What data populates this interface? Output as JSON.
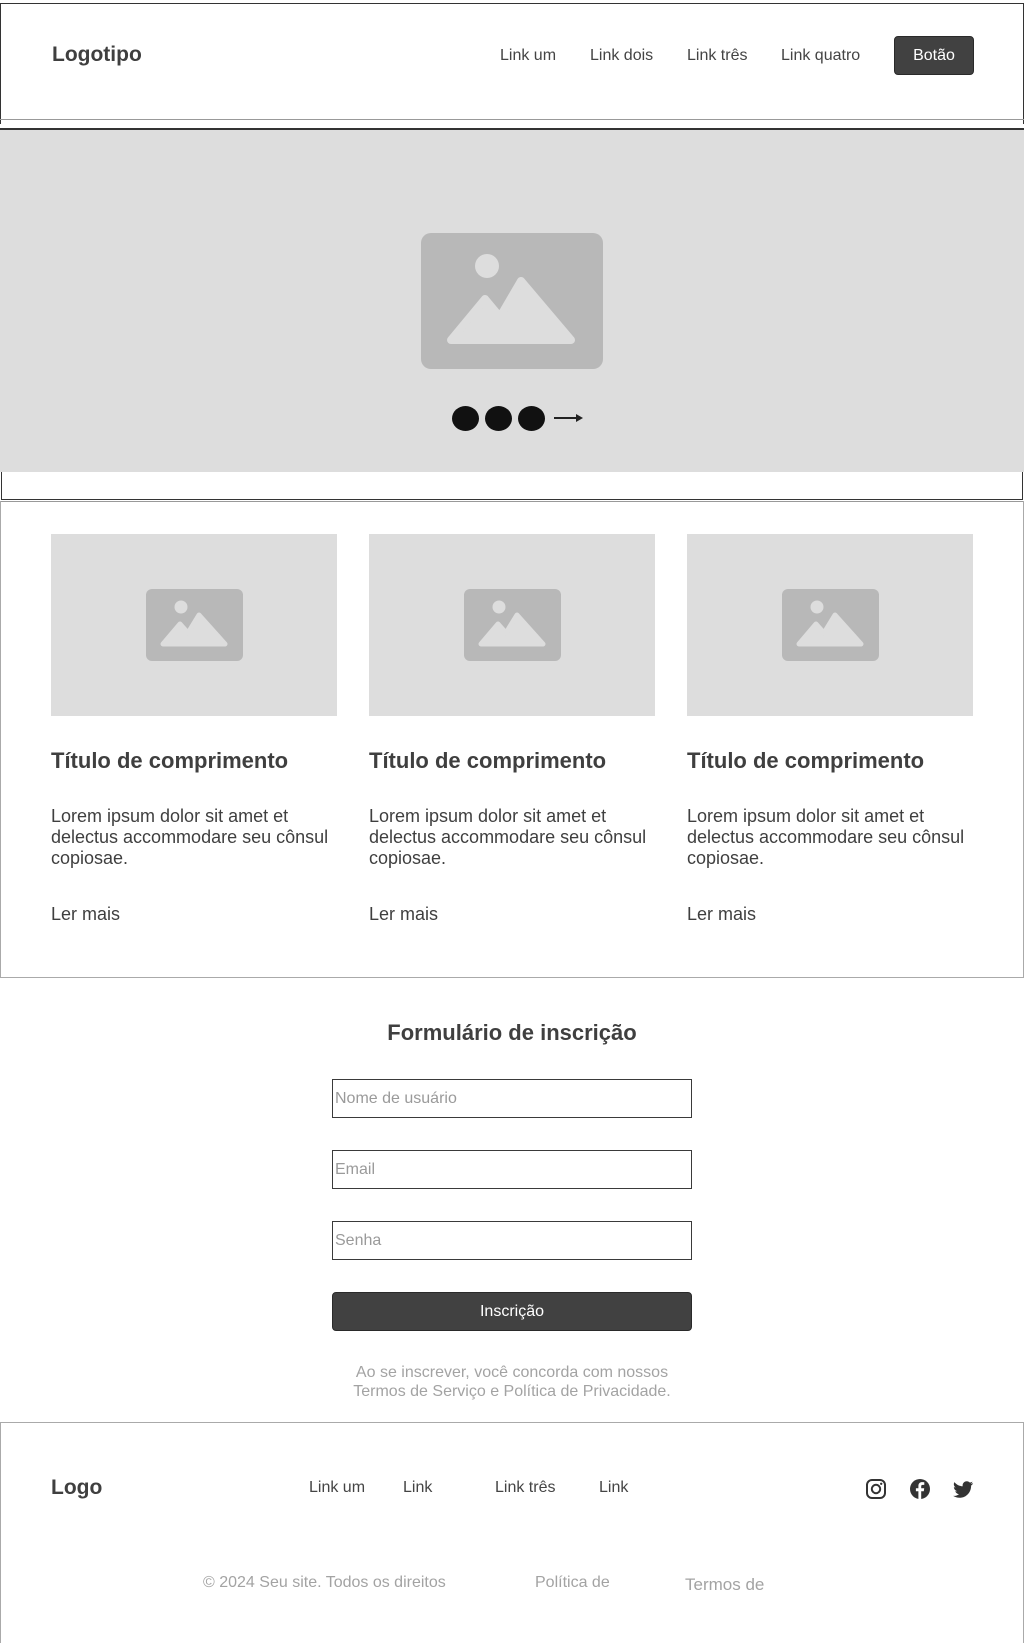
{
  "header": {
    "logo": "Logotipo",
    "nav": [
      "Link um",
      "Link dois",
      "Link três",
      "Link quatro"
    ],
    "button_label": "Botão"
  },
  "hero": {
    "image_icon": "image-placeholder-icon",
    "dots": 3,
    "next_icon": "arrow-right-icon"
  },
  "cards": [
    {
      "title": "Título de comprimento",
      "text": "Lorem ipsum dolor sit amet et delectus accommodare seu cônsul copiosae.",
      "link": "Ler mais"
    },
    {
      "title": "Título de comprimento",
      "text": "Lorem ipsum dolor sit amet et delectus accommodare seu cônsul copiosae.",
      "link": "Ler mais"
    },
    {
      "title": "Título de comprimento",
      "text": "Lorem ipsum dolor sit amet et delectus accommodare seu cônsul copiosae.",
      "link": "Ler mais"
    }
  ],
  "form": {
    "title": "Formulário de inscrição",
    "username_placeholder": "Nome de usuário",
    "email_placeholder": "Email",
    "password_placeholder": "Senha",
    "submit_label": "Inscrição",
    "note_line1": "Ao se inscrever, você concorda com nossos",
    "note_line2": "Termos de Serviço e Política de Privacidade."
  },
  "footer": {
    "logo": "Logo",
    "links": [
      "Link um",
      "Link",
      "Link três",
      "Link"
    ],
    "social_icons": [
      "instagram-icon",
      "facebook-icon",
      "twitter-icon"
    ],
    "copyright": "© 2024 Seu site. Todos os direitos",
    "privacy": "Política de",
    "terms": "Termos de"
  },
  "colors": {
    "dark_button": "#414141",
    "placeholder_gray": "#dddddd",
    "icon_gray": "#b8b8b8",
    "muted_text": "#a3a3a3"
  }
}
